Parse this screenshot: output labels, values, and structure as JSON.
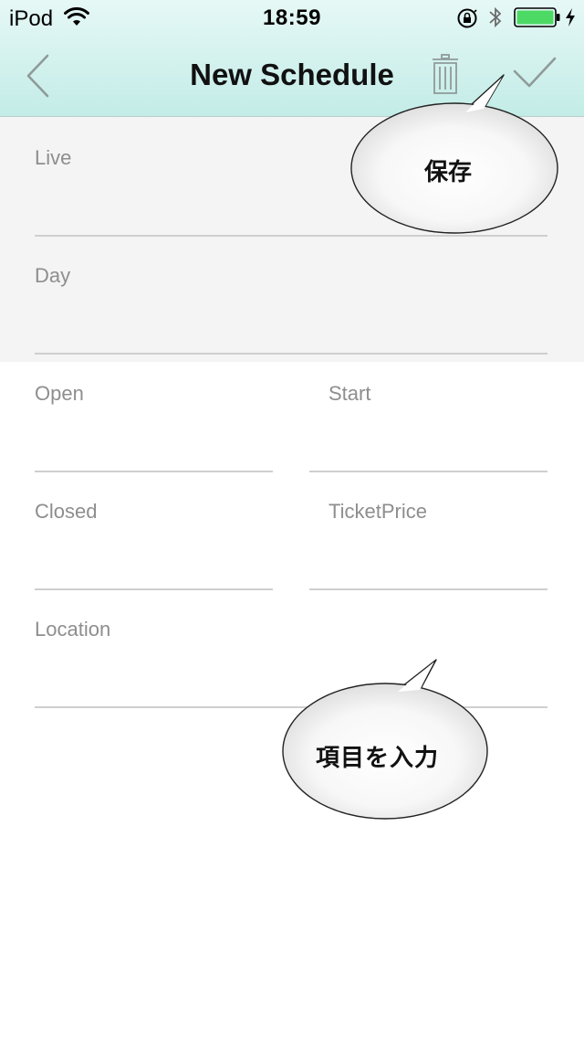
{
  "status_bar": {
    "carrier": "iPod",
    "time": "18:59"
  },
  "nav": {
    "title": "New Schedule",
    "back_icon": "chevron-left-icon",
    "delete_icon": "trash-icon",
    "save_icon": "checkmark-icon"
  },
  "form": {
    "live": {
      "label": "Live",
      "value": ""
    },
    "day": {
      "label": "Day",
      "value": ""
    },
    "open": {
      "label": "Open",
      "value": ""
    },
    "start": {
      "label": "Start",
      "value": ""
    },
    "closed": {
      "label": "Closed",
      "value": ""
    },
    "ticket_price": {
      "label": "TicketPrice",
      "value": ""
    },
    "location": {
      "label": "Location",
      "value": ""
    }
  },
  "annotations": {
    "save_callout": "保存",
    "input_callout": "項目を入力"
  },
  "colors": {
    "header_gradient_top": "#e6f8f6",
    "header_gradient_bottom": "#c3ece7",
    "battery_fill": "#4cd964",
    "label_gray": "#8e8e8e",
    "form_gray_background": "#f4f4f4"
  }
}
